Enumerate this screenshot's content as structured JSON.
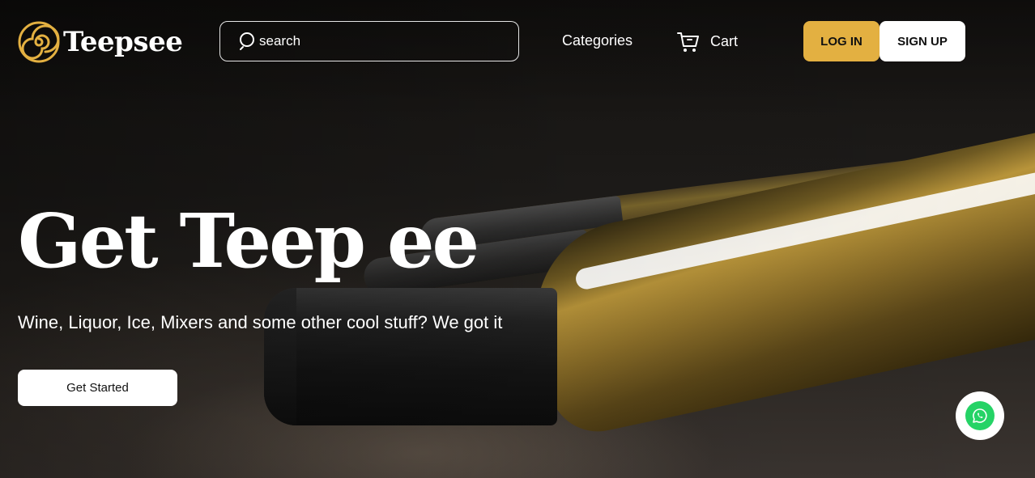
{
  "header": {
    "brand": "Teepsee",
    "search": {
      "placeholder": "search",
      "value": ""
    },
    "nav": {
      "categories": "Categories",
      "cart": "Cart"
    },
    "auth": {
      "login": "LOG IN",
      "signup": "SIGN UP"
    }
  },
  "hero": {
    "title": "Get Teep ee",
    "subtitle": "Wine, Liquor, Ice, Mixers and some other cool stuff? We got it",
    "cta": "Get Started"
  },
  "icons": {
    "logo": "spiral-logo-icon",
    "search": "search-icon",
    "cart": "cart-icon",
    "chat": "whatsapp-icon"
  },
  "colors": {
    "accent": "#e3b041",
    "whatsapp": "#25d366",
    "background": "#141210"
  }
}
